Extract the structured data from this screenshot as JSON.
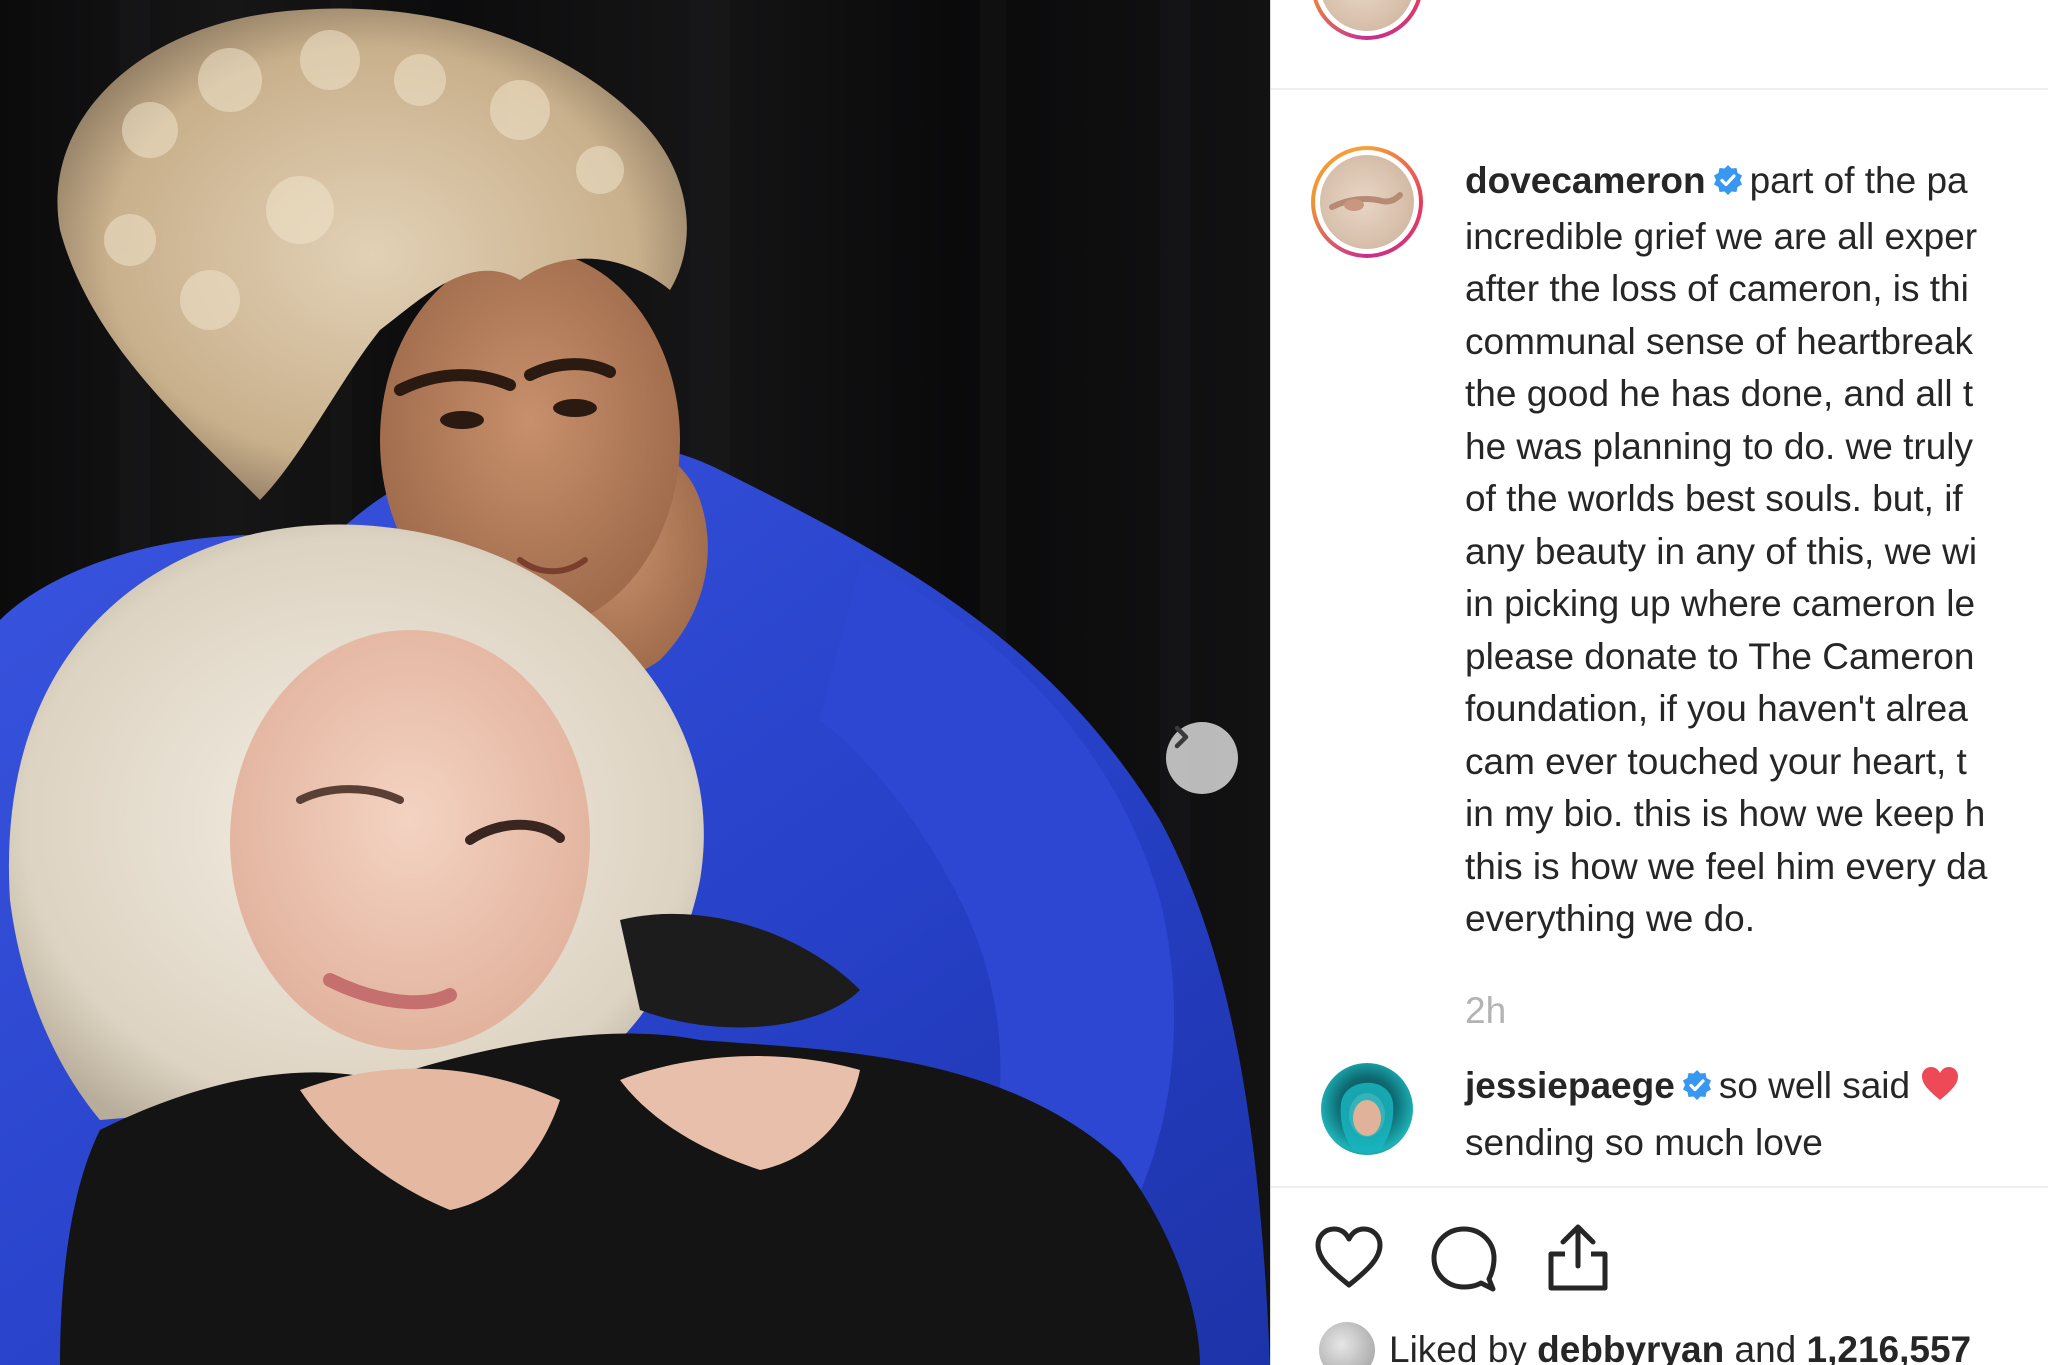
{
  "post": {
    "top_partial_text": "",
    "caption": {
      "username": "dovecameron",
      "lines": [
        "part of the pa",
        "incredible grief we are all exper",
        "after the loss of cameron, is thi",
        "communal sense of heartbreak",
        "the good he has done, and all t",
        "he was planning to do. we truly",
        "of the worlds best souls. but, if",
        "any beauty in any of this, we wi",
        "in picking up where cameron le",
        "please donate to The Cameron",
        "foundation, if you haven't alrea",
        "cam ever touched your heart, t",
        "in my bio. this is how we keep h",
        "this is how we feel him every da",
        "everything we do."
      ]
    },
    "timestamp": "2h",
    "comment": {
      "username": "jessiepaege",
      "text_line1": "so well said",
      "text_line2": "sending so much love"
    },
    "likes": {
      "prefix": "Liked by",
      "user": "debbyryan",
      "connector": "and",
      "count": "1,216,557"
    }
  },
  "icons": {
    "verified": "verified-badge-icon",
    "heart": "heart-icon",
    "comment": "comment-bubble-icon",
    "share": "share-icon",
    "carousel_next": "chevron-right-icon",
    "emoji": "red-heart-emoji-icon"
  },
  "colors": {
    "verified_blue": "#3897f0",
    "timestamp_gray": "#b3b3b3",
    "heart_red": "#ed4956",
    "sweater_blue": "#2a43c8"
  }
}
